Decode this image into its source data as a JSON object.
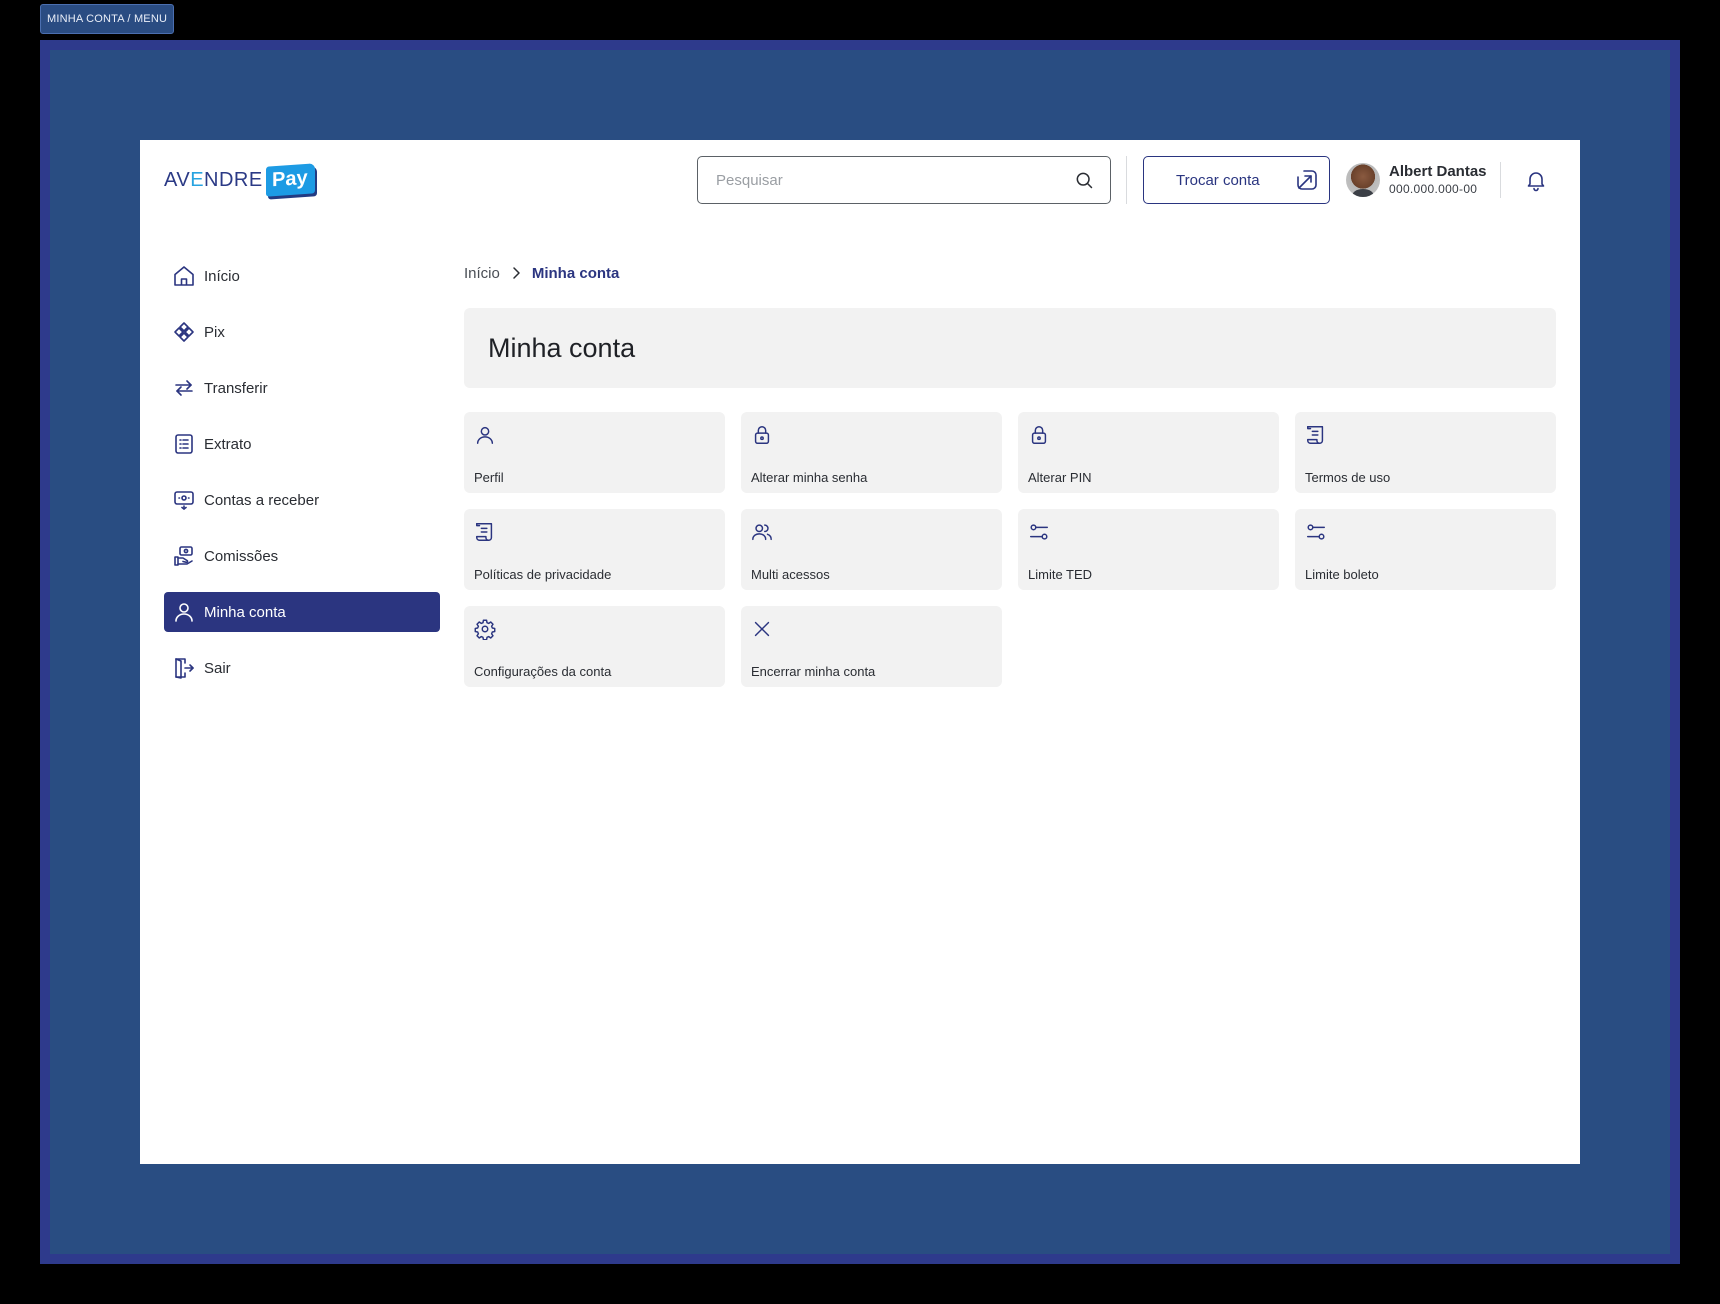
{
  "frame": {
    "tag": "MINHA CONTA / MENU"
  },
  "header": {
    "logo": {
      "text_a": "AV",
      "text_b": "E",
      "text_c": "NDRE",
      "pay": "Pay"
    },
    "search": {
      "placeholder": "Pesquisar",
      "value": ""
    },
    "switch_account_label": "Trocar conta",
    "user": {
      "name": "Albert Dantas",
      "document": "000.000.000-00"
    }
  },
  "sidebar": {
    "items": [
      {
        "label": "Início",
        "icon": "home-icon",
        "active": false
      },
      {
        "label": "Pix",
        "icon": "pix-icon",
        "active": false
      },
      {
        "label": "Transferir",
        "icon": "transfer-icon",
        "active": false
      },
      {
        "label": "Extrato",
        "icon": "statement-icon",
        "active": false
      },
      {
        "label": "Contas a receber",
        "icon": "receivables-icon",
        "active": false
      },
      {
        "label": "Comissões",
        "icon": "commission-icon",
        "active": false
      },
      {
        "label": "Minha conta",
        "icon": "user-icon",
        "active": true
      },
      {
        "label": "Sair",
        "icon": "logout-icon",
        "active": false
      }
    ]
  },
  "breadcrumb": {
    "home": "Início",
    "current": "Minha conta"
  },
  "page": {
    "title": "Minha conta"
  },
  "cards": [
    {
      "label": "Perfil",
      "icon": "user-icon"
    },
    {
      "label": "Alterar minha senha",
      "icon": "lock-icon"
    },
    {
      "label": "Alterar PIN",
      "icon": "lock-icon"
    },
    {
      "label": "Termos de uso",
      "icon": "scroll-icon"
    },
    {
      "label": "Políticas de privacidade",
      "icon": "scroll-icon"
    },
    {
      "label": "Multi acessos",
      "icon": "users-icon"
    },
    {
      "label": "Limite TED",
      "icon": "sliders-icon"
    },
    {
      "label": "Limite boleto",
      "icon": "sliders-icon"
    },
    {
      "label": "Configurações da conta",
      "icon": "gear-icon"
    },
    {
      "label": "Encerrar minha conta",
      "icon": "close-icon"
    }
  ],
  "colors": {
    "primary": "#2b3580",
    "card_bg": "#f2f2f2",
    "frame_outer": "#2e3a8c",
    "frame_inner": "#294d82",
    "logo_pay": "#1d9be4"
  }
}
